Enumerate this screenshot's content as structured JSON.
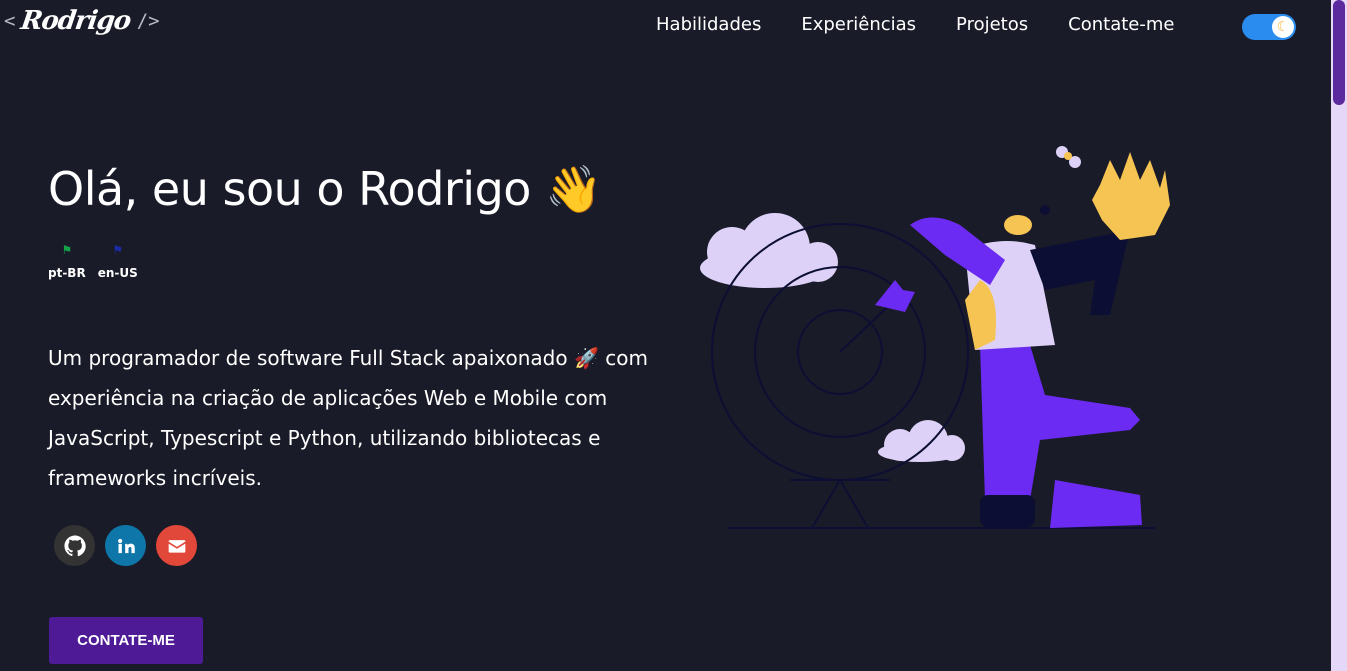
{
  "logo": {
    "open": "<",
    "name": "Rodrigo",
    "close": "/>"
  },
  "nav": {
    "items": [
      "Habilidades",
      "Experiências",
      "Projetos",
      "Contate-me"
    ]
  },
  "theme_toggle": {
    "icon": "moon-icon"
  },
  "hero": {
    "title": "Olá, eu sou o Rodrigo 👋",
    "languages": [
      {
        "code": "pt-BR",
        "flag": "⚑",
        "color": "#14a34a"
      },
      {
        "code": "en-US",
        "flag": "⚑",
        "color": "#1b2aa6"
      }
    ],
    "description": "Um programador de software Full Stack apaixonado 🚀 com experiência na criação de aplicações Web e Mobile com JavaScript, Typescript e Python, utilizando bibliotecas e frameworks incríveis.",
    "cta_label": "CONTATE-ME"
  },
  "socials": [
    "github-icon",
    "linkedin-icon",
    "email-icon"
  ],
  "colors": {
    "background": "#1a1b28",
    "accent": "#4e1a96",
    "purple": "#6c2bf2",
    "lavender": "#dcd3f5",
    "skin": "#f5c452"
  }
}
